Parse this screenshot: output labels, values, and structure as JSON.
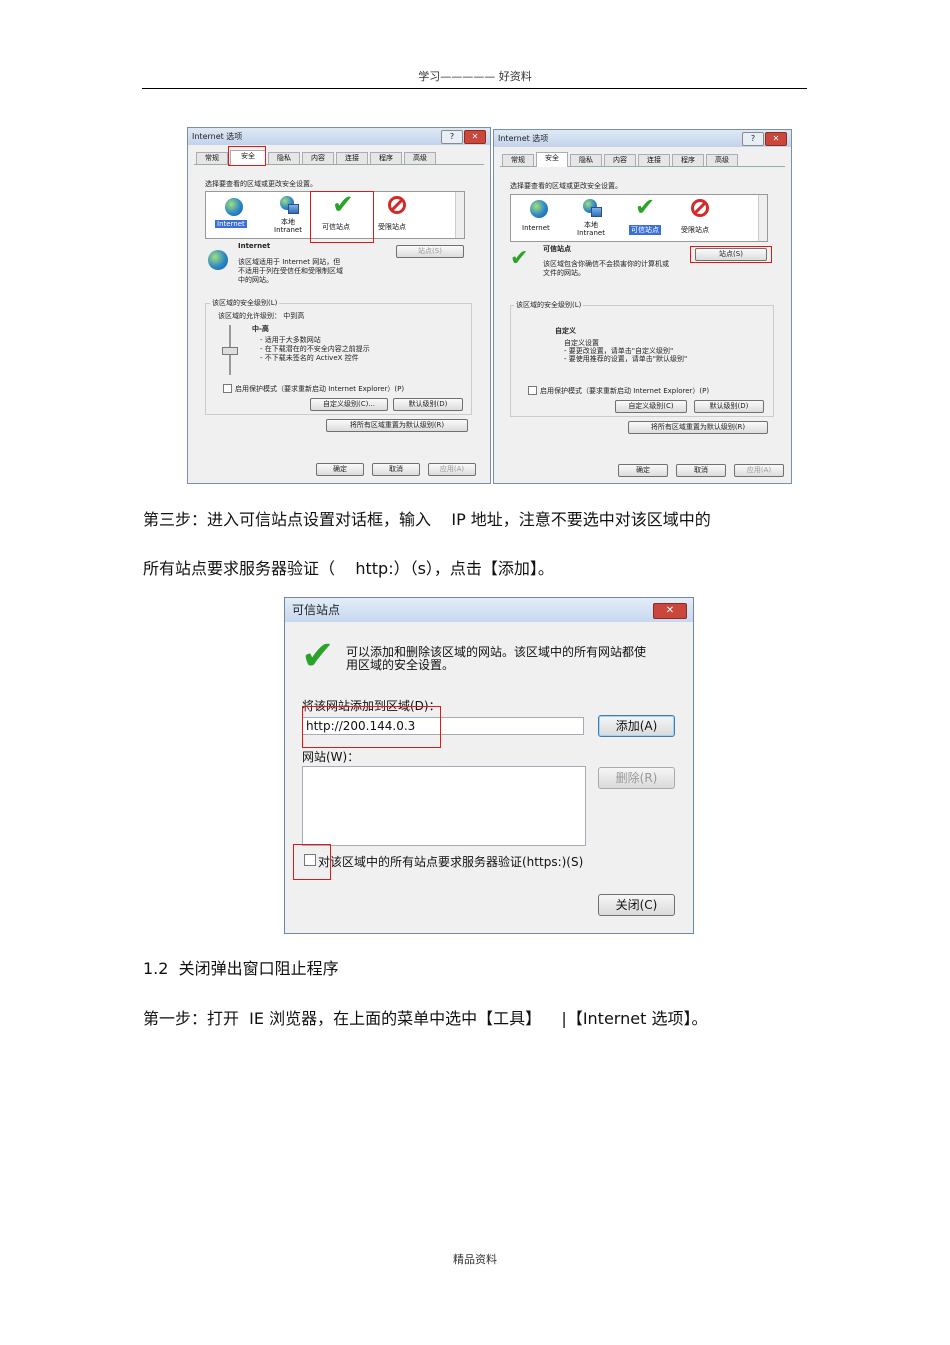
{
  "header": {
    "text": "学习————— 好资料"
  },
  "footer": {
    "text": "精品资料"
  },
  "paragraphs": {
    "step3_line1": "第三步：进入可信站点设置对话框，输入    IP 地址，注意不要选中对该区域中的",
    "step3_line2": "所有站点要求服务器验证（    http:）（s），点击【添加】。",
    "section_title": "1.2  关闭弹出窗口阻止程序",
    "step1": "第一步：打开  IE 浏览器，在上面的菜单中选中【工具】    |【Internet 选项】。"
  },
  "dialog_left": {
    "title": "Internet 选项",
    "help_btn": "?",
    "close_btn": "✕",
    "tabs": [
      "常规",
      "安全",
      "隐私",
      "内容",
      "连接",
      "程序",
      "高级"
    ],
    "prompt": "选择要查看的区域或更改安全设置。",
    "zones": [
      "Internet",
      "本地\nIntranet",
      "可信站点",
      "受限站点"
    ],
    "zone_name": "Internet",
    "zone_desc": [
      "该区域适用于 Internet 网站，但",
      "不适用于列在受信任和受限制区域",
      "中的网站。"
    ],
    "sites_btn": "站点(S)",
    "level_group": "该区域的安全级别(L)",
    "allowed": "该区域的允许级别：  中到高",
    "level_name": "中-高",
    "level_bullets": [
      "- 适用于大多数网站",
      "- 在下载潜在的不安全内容之前提示",
      "- 不下载未签名的 ActiveX 控件"
    ],
    "protected_mode": "启用保护模式（要求重新启动 Internet Explorer）(P)",
    "custom_btn": "自定义级别(C)...",
    "default_btn": "默认级别(D)",
    "reset_btn": "将所有区域重置为默认级别(R)",
    "ok": "确定",
    "cancel": "取消",
    "apply": "应用(A)"
  },
  "dialog_right": {
    "title": "Internet 选项",
    "help_btn": "?",
    "close_btn": "✕",
    "tabs": [
      "常规",
      "安全",
      "隐私",
      "内容",
      "连接",
      "程序",
      "高级"
    ],
    "prompt": "选择要查看的区域或更改安全设置。",
    "zones": [
      "Internet",
      "本地\nIntranet",
      "可信站点",
      "受限站点"
    ],
    "zone_name": "可信站点",
    "zone_desc": [
      "该区域包含你确信不会损害你的计算机或",
      "文件的网站。"
    ],
    "sites_btn": "站点(S)",
    "level_group": "该区域的安全级别(L)",
    "level_name": "自定义",
    "level_bullets": [
      "自定义设置",
      "- 要更改设置，请单击\"自定义级别\"",
      "- 要使用推荐的设置，请单击\"默认级别\""
    ],
    "protected_mode": "启用保护模式（要求重新启动 Internet Explorer）(P)",
    "custom_btn": "自定义级别(C)",
    "default_btn": "默认级别(D)",
    "reset_btn": "将所有区域重置为默认级别(R)",
    "ok": "确定",
    "cancel": "取消",
    "apply": "应用(A)"
  },
  "trusted_dialog": {
    "title": "可信站点",
    "close_btn": "✕",
    "desc_line1": "可以添加和删除该区域的网站。该区域中的所有网站都使",
    "desc_line2": "用区域的安全设置。",
    "add_label": "将该网站添加到区域(D)：",
    "url_value": "http://200.144.0.3",
    "add_btn": "添加(A)",
    "sites_label": "网站(W)：",
    "remove_btn": "删除(R)",
    "https_checkbox": "对该区域中的所有站点要求服务器验证(https:)(S)",
    "close_button": "关闭(C)"
  }
}
